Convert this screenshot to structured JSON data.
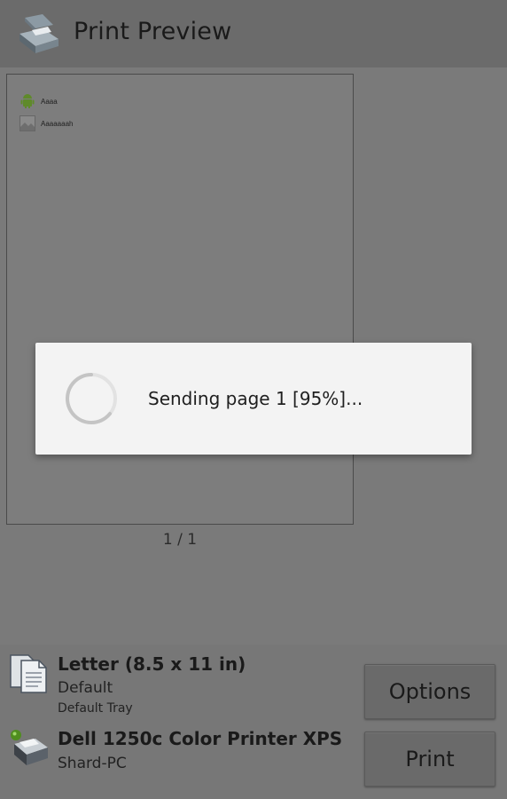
{
  "actionbar": {
    "title": "Print Preview",
    "icon": "printer-app-icon"
  },
  "preview": {
    "rows": [
      {
        "icon": "android-icon",
        "text": "Aaaa"
      },
      {
        "icon": "image-thumbnail-icon",
        "text": "Aaaaaaah"
      }
    ],
    "page_counter": "1 / 1"
  },
  "dialog": {
    "message": "Sending page 1 [95%]...",
    "progress_percent": 95
  },
  "paper": {
    "size": "Letter (8.5 x 11 in)",
    "type": "Default",
    "tray": "Default Tray",
    "icon": "document-icon"
  },
  "printer": {
    "name": "Dell 1250c Color Printer XPS",
    "host": "Shard-PC",
    "icon": "printer-icon"
  },
  "buttons": {
    "options_label": "Options",
    "print_label": "Print"
  },
  "colors": {
    "dim_background": "#7a7a7a",
    "dialog_background": "#f3f3f3"
  }
}
